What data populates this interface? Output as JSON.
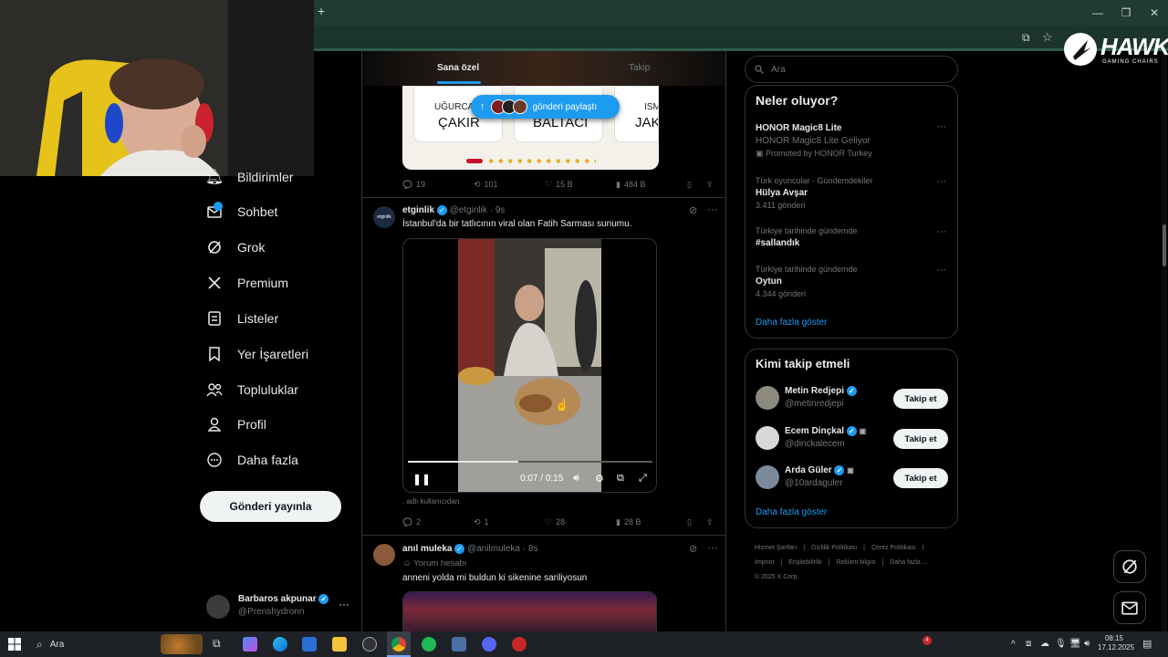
{
  "browser": {
    "new_tab": "+"
  },
  "window": {
    "minimize": "—",
    "restore": "❐",
    "close": "✕"
  },
  "brand": {
    "name": "HAWK",
    "tagline": "GAMING CHAIRS"
  },
  "feed_tabs": {
    "for_you": "Sana özel",
    "following": "Takip"
  },
  "share_pill": {
    "label": "gönderi paylaştı"
  },
  "carousel": {
    "names": [
      {
        "first": "UĞURCA",
        "last": "ÇAKIR"
      },
      {
        "first": "",
        "last": "BALTACI"
      },
      {
        "first": "ISM",
        "last": "JAK"
      }
    ]
  },
  "post1_stats": {
    "replies": "19",
    "reposts": "101",
    "likes": "15 B",
    "views": "484 B"
  },
  "post2": {
    "display_name": "etginlik",
    "handle": "@etginlik",
    "time": "· 9s",
    "avatar_text": "etginlik",
    "text": "İstanbul'da bir tatlıcının viral olan Fatih Sarması sunumu.",
    "video_time": "0:07 / 0:15",
    "attribution": ". adlı kullanıcıdan",
    "replies": "2",
    "reposts": "1",
    "likes": "28",
    "views": "28 B"
  },
  "post3": {
    "display_name": "anıl muleka",
    "handle": "@anilmuleka",
    "time": "· 8s",
    "badge": "Yorum hesabı",
    "text": "anneni yolda mi buldun ki sikenine sariliyosun"
  },
  "left_nav": [
    {
      "label": "Bildirimler",
      "icon": "bell-icon"
    },
    {
      "label": "Sohbet",
      "icon": "mail-icon"
    },
    {
      "label": "Grok",
      "icon": "grok-icon"
    },
    {
      "label": "Premium",
      "icon": "x-logo-icon"
    },
    {
      "label": "Listeler",
      "icon": "list-icon"
    },
    {
      "label": "Yer İşaretleri",
      "icon": "bookmark-icon"
    },
    {
      "label": "Topluluklar",
      "icon": "people-icon"
    },
    {
      "label": "Profil",
      "icon": "person-icon"
    },
    {
      "label": "Daha fazla",
      "icon": "more-circle-icon"
    }
  ],
  "post_button": "Gönderi yayınla",
  "account": {
    "name": "Barbaros akpunar",
    "handle": "@Prenshydronn"
  },
  "search": {
    "placeholder": "Ara"
  },
  "trends": {
    "title": "Neler oluyor?",
    "items": [
      {
        "meta": "",
        "title": "HONOR Magic8 Lite",
        "sub": "HONOR Magic8 Lite Geliyor",
        "promo": "Promoted by HONOR Turkey"
      },
      {
        "meta": "Türk oyuncular · Gündemdekiler",
        "title": "Hülya Avşar",
        "sub": "3.411 gönderi"
      },
      {
        "meta": "Türkiye tarihinde gündemde",
        "title": "#sallandık",
        "sub": ""
      },
      {
        "meta": "Türkiye tarihinde gündemde",
        "title": "Oytun",
        "sub": "4.344 gönderi"
      }
    ],
    "show_more": "Daha fazla göster"
  },
  "who_to_follow": {
    "title": "Kimi takip etmeli",
    "users": [
      {
        "name": "Metin Redjepi",
        "handle": "@metinredjepi",
        "button": "Takip et"
      },
      {
        "name": "Ecem Dinçkal",
        "handle": "@dinckalecem",
        "button": "Takip et"
      },
      {
        "name": "Arda Güler",
        "handle": "@10ardaguler",
        "button": "Takip et"
      }
    ],
    "show_more": "Daha fazla göster"
  },
  "footer": {
    "row1": [
      "Hizmet Şartları",
      "Gizlilik Politikası",
      "Çerez Politikası"
    ],
    "row2": [
      "Imprint",
      "Erişilebilirlik",
      "Reklam bilgisi",
      "Daha fazla ..."
    ],
    "copyright": "© 2025 X Corp."
  },
  "taskbar": {
    "search_label": "Ara",
    "time": "08:15",
    "date": "17.12.2025",
    "notification_count": "4"
  },
  "colors": {
    "accent": "#1d9bf0",
    "browser_frame": "#1f3b33",
    "taskbar": "#1e2227"
  }
}
